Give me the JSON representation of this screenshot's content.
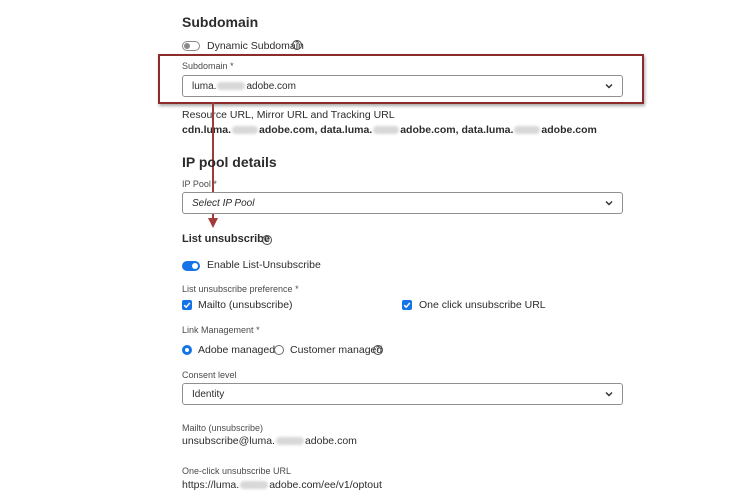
{
  "subdomain_section": {
    "title": "Subdomain",
    "dynamic_toggle_label": "Dynamic Subdomain",
    "field_label": "Subdomain",
    "required_star": "*",
    "value_prefix": "luma.",
    "value_suffix": "adobe.com",
    "info_label": "Resource URL, Mirror URL and Tracking URL",
    "info_part1": "cdn.luma.",
    "info_part2": "adobe.com, data.luma.",
    "info_part3": "adobe.com, data.luma.",
    "info_part4": "adobe.com"
  },
  "ip_pool_section": {
    "title": "IP pool details",
    "field_label": "IP Pool",
    "required_star": "*",
    "placeholder": "Select IP Pool"
  },
  "unsubscribe_section": {
    "title": "List unsubscribe",
    "enable_label": "Enable List-Unsubscribe",
    "preference_label": "List unsubscribe preference *",
    "mailto_checkbox": "Mailto (unsubscribe)",
    "oneclick_checkbox": "One click unsubscribe URL",
    "link_mgmt_label": "Link Management",
    "required_star": "*",
    "adobe_managed": "Adobe managed",
    "customer_managed": "Customer managed",
    "consent_label": "Consent level",
    "consent_value": "Identity",
    "mailto_field_label": "Mailto (unsubscribe)",
    "mailto_value_prefix": "unsubscribe@luma.",
    "mailto_value_suffix": "adobe.com",
    "oneclick_field_label": "One-click unsubscribe URL",
    "oneclick_value_prefix": "https://luma.",
    "oneclick_value_suffix": "adobe.com/ee/v1/optout"
  },
  "colors": {
    "accent": "#1473e6",
    "highlight_border": "#8b2b2b",
    "arrow": "#a33a3a"
  },
  "icons": {
    "help": "help-circle-icon",
    "chevron": "chevron-down-icon",
    "check": "checkmark-icon"
  }
}
